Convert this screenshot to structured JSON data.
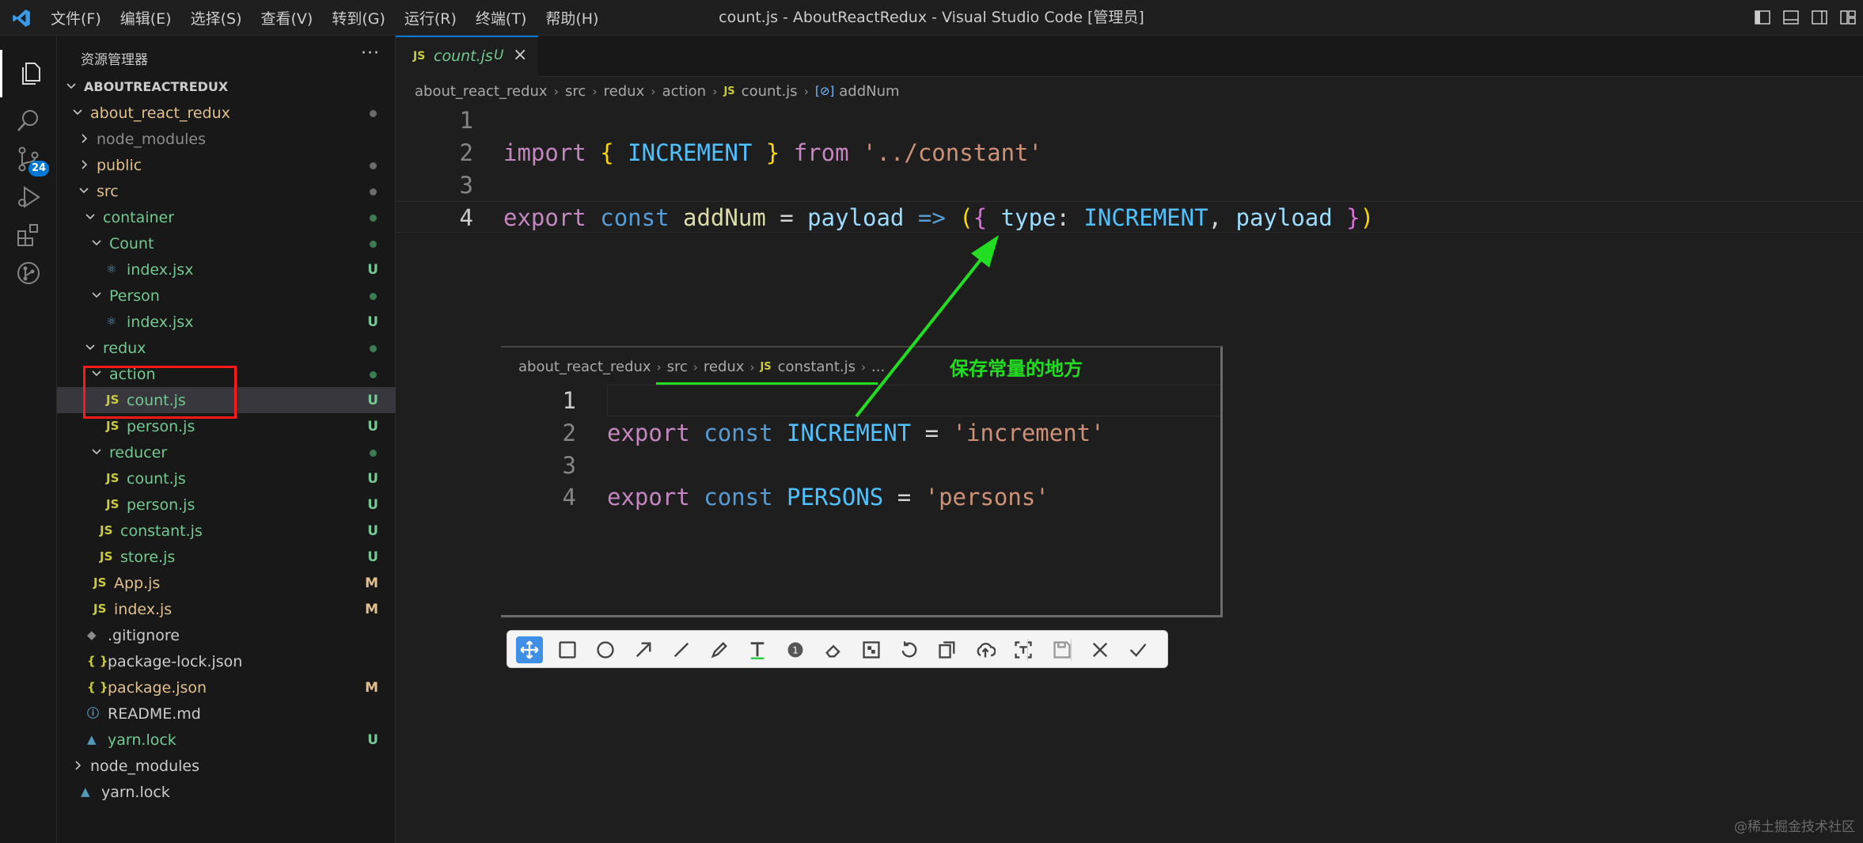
{
  "window": {
    "title": "count.js - AboutReactRedux - Visual Studio Code [管理员]",
    "menu": [
      "文件(F)",
      "编辑(E)",
      "选择(S)",
      "查看(V)",
      "转到(G)",
      "运行(R)",
      "终端(T)",
      "帮助(H)"
    ]
  },
  "activity_bar": {
    "items": [
      {
        "icon": "files-icon",
        "active": true
      },
      {
        "icon": "search-icon",
        "active": false
      },
      {
        "icon": "source-control-icon",
        "active": false,
        "badge": "24"
      },
      {
        "icon": "run-debug-icon",
        "active": false
      },
      {
        "icon": "extensions-icon",
        "active": false
      },
      {
        "icon": "git-graph-icon",
        "active": false
      }
    ]
  },
  "sidebar": {
    "title": "资源管理器",
    "more": "···",
    "tree": [
      {
        "label": "ABOUTREACTREDUX",
        "kind": "root",
        "color": "white",
        "status": ""
      },
      {
        "label": "about_react_redux",
        "kind": "folder-open",
        "color": "yellow",
        "status": "dot-gray"
      },
      {
        "label": "node_modules",
        "kind": "folder-closed",
        "color": "gray",
        "status": ""
      },
      {
        "label": "public",
        "kind": "folder-closed",
        "color": "yellow",
        "status": "dot-gray"
      },
      {
        "label": "src",
        "kind": "folder-open",
        "color": "yellow",
        "status": "dot-gray"
      },
      {
        "label": "container",
        "kind": "folder-open",
        "color": "green",
        "status": "dot-green"
      },
      {
        "label": "Count",
        "kind": "folder-open",
        "color": "green",
        "status": "dot-green"
      },
      {
        "label": "index.jsx",
        "kind": "react",
        "color": "green",
        "status": "U"
      },
      {
        "label": "Person",
        "kind": "folder-open",
        "color": "green",
        "status": "dot-green"
      },
      {
        "label": "index.jsx",
        "kind": "react",
        "color": "green",
        "status": "U"
      },
      {
        "label": "redux",
        "kind": "folder-open",
        "color": "green",
        "status": "dot-green"
      },
      {
        "label": "action",
        "kind": "folder-open",
        "color": "green",
        "status": "dot-green"
      },
      {
        "label": "count.js",
        "kind": "js",
        "color": "green",
        "status": "U",
        "selected": true
      },
      {
        "label": "person.js",
        "kind": "js",
        "color": "green",
        "status": "U"
      },
      {
        "label": "reducer",
        "kind": "folder-open",
        "color": "green",
        "status": "dot-green"
      },
      {
        "label": "count.js",
        "kind": "js",
        "color": "green",
        "status": "U"
      },
      {
        "label": "person.js",
        "kind": "js",
        "color": "green",
        "status": "U"
      },
      {
        "label": "constant.js",
        "kind": "js",
        "color": "green",
        "status": "U"
      },
      {
        "label": "store.js",
        "kind": "js",
        "color": "green",
        "status": "U"
      },
      {
        "label": "App.js",
        "kind": "js",
        "color": "yellow",
        "status": "M"
      },
      {
        "label": "index.js",
        "kind": "js",
        "color": "yellow",
        "status": "M"
      },
      {
        "label": ".gitignore",
        "kind": "git",
        "color": "white",
        "status": ""
      },
      {
        "label": "package-lock.json",
        "kind": "json",
        "color": "white",
        "status": ""
      },
      {
        "label": "package.json",
        "kind": "json",
        "color": "yellow",
        "status": "M"
      },
      {
        "label": "README.md",
        "kind": "info",
        "color": "white",
        "status": ""
      },
      {
        "label": "yarn.lock",
        "kind": "yarn",
        "color": "green",
        "status": "U"
      },
      {
        "label": "node_modules",
        "kind": "folder-closed",
        "color": "white",
        "status": ""
      },
      {
        "label": "yarn.lock",
        "kind": "yarn",
        "color": "white",
        "status": ""
      }
    ]
  },
  "editor": {
    "tab": {
      "badge": "JS",
      "name": "count.js",
      "status": "U",
      "close": "×"
    },
    "breadcrumbs": [
      "about_react_redux",
      "src",
      "redux",
      "action"
    ],
    "breadcrumb_file": "count.js",
    "breadcrumb_file_badge": "JS",
    "breadcrumb_symbol": "addNum",
    "breadcrumb_symbol_icon": "[⊘]",
    "lines": [
      {
        "num": "1",
        "tokens": []
      },
      {
        "num": "2",
        "tokens": [
          {
            "t": "import",
            "c": "pink"
          },
          {
            "t": " ",
            "c": "plain"
          },
          {
            "t": "{",
            "c": "br1"
          },
          {
            "t": " INCREMENT ",
            "c": "const"
          },
          {
            "t": "}",
            "c": "br1"
          },
          {
            "t": " from ",
            "c": "pink"
          },
          {
            "t": "'../constant'",
            "c": "str"
          }
        ]
      },
      {
        "num": "3",
        "tokens": []
      },
      {
        "num": "4",
        "tokens": [
          {
            "t": "export",
            "c": "pink"
          },
          {
            "t": " ",
            "c": "plain"
          },
          {
            "t": "const",
            "c": "blue"
          },
          {
            "t": " ",
            "c": "plain"
          },
          {
            "t": "addNum",
            "c": "fn"
          },
          {
            "t": " = ",
            "c": "plain"
          },
          {
            "t": "payload",
            "c": "var"
          },
          {
            "t": " ",
            "c": "plain"
          },
          {
            "t": "=>",
            "c": "blue"
          },
          {
            "t": " ",
            "c": "plain"
          },
          {
            "t": "(",
            "c": "br1"
          },
          {
            "t": "{",
            "c": "br2"
          },
          {
            "t": " type",
            "c": "var"
          },
          {
            "t": ": ",
            "c": "plain"
          },
          {
            "t": "INCREMENT",
            "c": "const"
          },
          {
            "t": ", ",
            "c": "plain"
          },
          {
            "t": "payload",
            "c": "var"
          },
          {
            "t": " ",
            "c": "plain"
          },
          {
            "t": "}",
            "c": "br2"
          },
          {
            "t": ")",
            "c": "br1"
          }
        ]
      }
    ]
  },
  "snip": {
    "breadcrumbs": [
      "about_react_redux",
      "src",
      "redux"
    ],
    "breadcrumb_file": "constant.js",
    "breadcrumb_file_badge": "JS",
    "breadcrumb_more": "...",
    "lines": [
      {
        "num": "1",
        "tokens": []
      },
      {
        "num": "2",
        "tokens": [
          {
            "t": "export",
            "c": "pink"
          },
          {
            "t": " ",
            "c": "plain"
          },
          {
            "t": "const",
            "c": "blue"
          },
          {
            "t": " ",
            "c": "plain"
          },
          {
            "t": "INCREMENT",
            "c": "const"
          },
          {
            "t": " = ",
            "c": "plain"
          },
          {
            "t": "'increment'",
            "c": "str"
          }
        ]
      },
      {
        "num": "3",
        "tokens": []
      },
      {
        "num": "4",
        "tokens": [
          {
            "t": "export",
            "c": "pink"
          },
          {
            "t": " ",
            "c": "plain"
          },
          {
            "t": "const",
            "c": "blue"
          },
          {
            "t": " ",
            "c": "plain"
          },
          {
            "t": "PERSONS",
            "c": "const"
          },
          {
            "t": " = ",
            "c": "plain"
          },
          {
            "t": "'persons'",
            "c": "str"
          }
        ]
      }
    ],
    "annotation": "保存常量的地方",
    "toolbar": [
      "move-icon",
      "rectangle-icon",
      "ellipse-icon",
      "arrow-icon",
      "line-icon",
      "pen-icon",
      "text-icon",
      "number-marker-icon",
      "eraser-icon",
      "mosaic-icon",
      "undo-icon",
      "copy-icon",
      "upload-icon",
      "ocr-icon",
      "save-icon",
      "close-icon",
      "confirm-icon"
    ]
  },
  "colors": {
    "accent": "#0078d4",
    "untracked": "#73c991",
    "modified": "#e2c08d",
    "annotation_green": "#22dd22",
    "annotation_red": "#ff1a1a"
  },
  "watermark": "@稀土掘金技术社区"
}
